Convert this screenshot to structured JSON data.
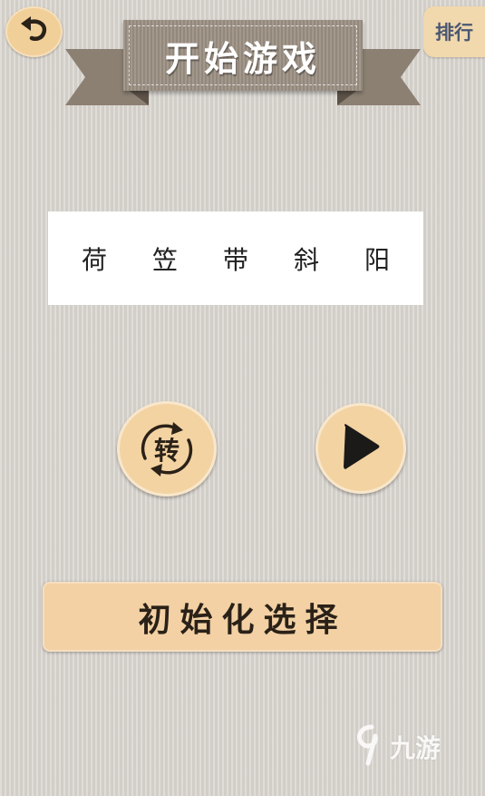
{
  "header": {
    "title": "开始游戏",
    "rank_label": "排行",
    "back_icon": "back-arrow-icon"
  },
  "puzzle": {
    "characters": [
      "荷",
      "笠",
      "带",
      "斜",
      "阳"
    ]
  },
  "controls": {
    "rotate_label": "转",
    "rotate_icon": "rotate-arrows-icon",
    "play_icon": "play-triangle-icon",
    "init_label": "初始化选择"
  },
  "watermark": {
    "text": "九游",
    "icon": "jiuyou-logo-icon"
  },
  "colors": {
    "background": "#d9d5cf",
    "button_fill": "#f3d3a2",
    "banner": "#9b8f82",
    "ink": "#2a2118"
  }
}
